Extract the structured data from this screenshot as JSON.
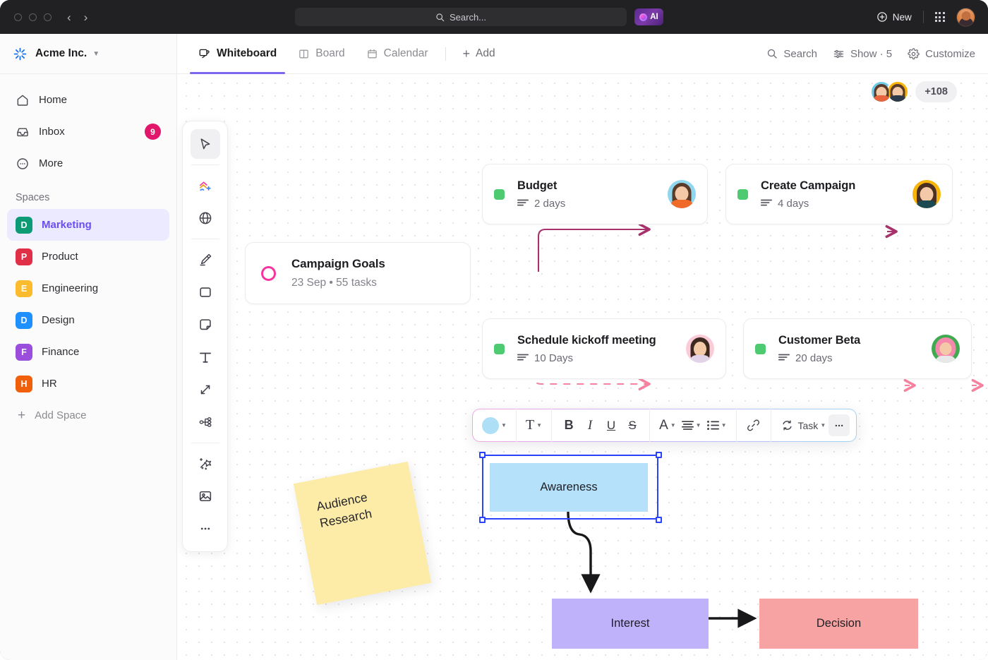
{
  "titlebar": {
    "search_placeholder": "Search...",
    "ai_label": "AI",
    "new_label": "New"
  },
  "sidebar": {
    "workspace": "Acme Inc.",
    "nav": [
      {
        "label": "Home",
        "icon": "home-icon",
        "badge": ""
      },
      {
        "label": "Inbox",
        "icon": "inbox-icon",
        "badge": "9"
      },
      {
        "label": "More",
        "icon": "more-icon",
        "badge": ""
      }
    ],
    "spaces_title": "Spaces",
    "spaces": [
      {
        "label": "Marketing",
        "initial": "D",
        "color": "#0d9b76",
        "active": true
      },
      {
        "label": "Product",
        "initial": "P",
        "color": "#e03047",
        "active": false
      },
      {
        "label": "Engineering",
        "initial": "E",
        "color": "#fbbb2e",
        "active": false
      },
      {
        "label": "Design",
        "initial": "D",
        "color": "#1e90ff",
        "active": false
      },
      {
        "label": "Finance",
        "initial": "F",
        "color": "#9b4ddb",
        "active": false
      },
      {
        "label": "HR",
        "initial": "H",
        "color": "#f0600a",
        "active": false
      }
    ],
    "add_space": "Add Space"
  },
  "topbar": {
    "tabs": [
      {
        "label": "Whiteboard",
        "icon": "whiteboard-icon",
        "active": true
      },
      {
        "label": "Board",
        "icon": "board-icon",
        "active": false
      },
      {
        "label": "Calendar",
        "icon": "calendar-icon",
        "active": false
      }
    ],
    "add_label": "Add",
    "right": [
      {
        "label": "Search",
        "icon": "search-icon"
      },
      {
        "label": "Show · 5",
        "icon": "show-icon"
      },
      {
        "label": "Customize",
        "icon": "gear-icon"
      }
    ]
  },
  "canvas": {
    "collaborators_overflow": "+108",
    "goal_card": {
      "title": "Campaign Goals",
      "meta": "23 Sep  •  55 tasks"
    },
    "task_cards": [
      {
        "title": "Budget",
        "duration": "2 days"
      },
      {
        "title": "Create Campaign",
        "duration": "4 days"
      },
      {
        "title": "Schedule kickoff meeting",
        "duration": "10 Days"
      },
      {
        "title": "Customer Beta",
        "duration": "20 days"
      }
    ],
    "sticky_note": {
      "line1": "Audience",
      "line2": "Research"
    },
    "shapes": [
      {
        "label": "Awareness",
        "color": "#b5e1fa",
        "selected": true
      },
      {
        "label": "Interest",
        "color": "#bfb2fa",
        "selected": false
      },
      {
        "label": "Decision",
        "color": "#f7a3a3",
        "selected": false
      }
    ]
  },
  "format_toolbar": {
    "color_label": "",
    "font_label": "T",
    "bold": "B",
    "italic": "I",
    "underline": "U",
    "strike": "S",
    "text_color": "A",
    "task_label": "Task",
    "more": "•••"
  },
  "tools": [
    "cursor-icon",
    "draw-shape-icon",
    "globe-icon",
    "highlighter-icon",
    "rectangle-icon",
    "sticky-note-icon",
    "text-icon",
    "connector-icon",
    "mindmap-icon",
    "magic-icon",
    "image-icon",
    "more-tools-icon"
  ]
}
